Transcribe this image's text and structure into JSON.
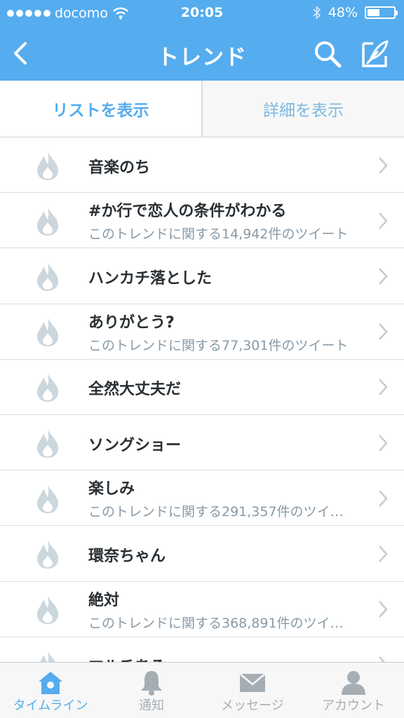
{
  "status_bar": {
    "carrier": "docomo",
    "time": "20:05",
    "battery": "48%",
    "battery_level": 0.48
  },
  "nav": {
    "title": "トレンド",
    "icons": [
      "back-chevron-icon",
      "search-icon",
      "compose-icon"
    ]
  },
  "segments": [
    {
      "label": "リストを表示",
      "active": true
    },
    {
      "label": "詳細を表示",
      "active": false
    }
  ],
  "trends": [
    {
      "name": "音楽のち",
      "detail": ""
    },
    {
      "name": "#か行で恋人の条件がわかる",
      "detail": "このトレンドに関する14,942件のツイート"
    },
    {
      "name": "ハンカチ落とした",
      "detail": ""
    },
    {
      "name": "ありがとう?",
      "detail": "このトレンドに関する77,301件のツイート"
    },
    {
      "name": "全然大丈夫だ",
      "detail": ""
    },
    {
      "name": "ソングショー",
      "detail": ""
    },
    {
      "name": "楽しみ",
      "detail": "このトレンドに関する291,357件のツイ…"
    },
    {
      "name": "環奈ちゃん",
      "detail": ""
    },
    {
      "name": "絶対",
      "detail": "このトレンドに関する368,891件のツイ…"
    },
    {
      "name": "マルチある",
      "detail": ""
    }
  ],
  "tabbar": [
    {
      "label": "タイムライン",
      "icon": "home-icon",
      "active": true
    },
    {
      "label": "通知",
      "icon": "bell-icon",
      "active": false
    },
    {
      "label": "メッセージ",
      "icon": "envelope-icon",
      "active": false
    },
    {
      "label": "アカウント",
      "icon": "person-icon",
      "active": false
    }
  ],
  "colors": {
    "brand_blue": "#55acee",
    "text_dark": "#292f33",
    "text_gray": "#8899a6",
    "icon_gray": "#ccd6dd"
  }
}
